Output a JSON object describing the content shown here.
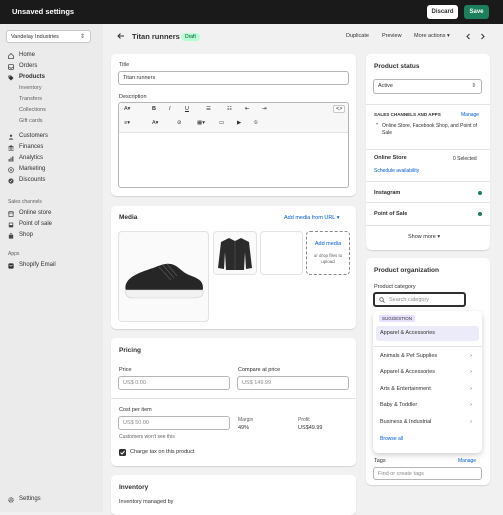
{
  "topbar": {
    "title": "Unsaved settings",
    "discard": "Discard",
    "save": "Save"
  },
  "sidebar": {
    "store": "Vandelay Industries",
    "items": [
      "Home",
      "Orders",
      "Products",
      "Inventory",
      "Transfers",
      "Collections",
      "Gift cards",
      "Customers",
      "Finances",
      "Analytics",
      "Marketing",
      "Discounts"
    ],
    "sales_label": "Sales channels",
    "sales": [
      "Online store",
      "Point of sale",
      "Shop"
    ],
    "apps_label": "Apps",
    "apps": [
      "Shopify Email"
    ],
    "settings": "Settings"
  },
  "header": {
    "title": "Titan runners",
    "badge": "Draft",
    "duplicate": "Duplicate",
    "preview": "Preview",
    "more": "More actions"
  },
  "title_card": {
    "title_label": "Title",
    "title_value": "Titan runners",
    "desc_label": "Description"
  },
  "media": {
    "heading": "Media",
    "add_from_url": "Add media from URL",
    "add_media": "Add media",
    "drop_hint": "or drop files to upload"
  },
  "pricing": {
    "heading": "Pricing",
    "price_label": "Price",
    "price_value": "US$  0.00",
    "compare_label": "Compare at price",
    "compare_value": "US$  149.99",
    "cost_label": "Cost per item",
    "cost_value": "US$  50.00",
    "cost_hint": "Customers won't see this",
    "margin_label": "Margin",
    "margin_value": "49%",
    "profit_label": "Profit",
    "profit_value": "US$49.99",
    "tax_label": "Charge tax on this product"
  },
  "inventory": {
    "heading": "Inventory",
    "managed_label": "Inventory managed by"
  },
  "status": {
    "heading": "Product status",
    "value": "Active",
    "channels_label": "SALES CHANNELS AND APPS",
    "manage": "Manage",
    "channels_desc": "Online Store, Facebook Shop, and Point of Sale",
    "online_store": "Online Store",
    "selected": "0 Selected",
    "schedule": "Schedule availability",
    "instagram": "Instagram",
    "pos": "Point of Sale",
    "show_more": "Show more"
  },
  "organization": {
    "heading": "Product organization",
    "category_label": "Product category",
    "search_placeholder": "Search category",
    "suggestion": "SUGGESTION",
    "suggested": "Apparel & Accessories",
    "categories": [
      "Animals & Pet Supplies",
      "Apparel & Accessories",
      "Arts & Entertainment",
      "Baby & Toddler",
      "Business & Industrial"
    ],
    "browse_all": "Browse all",
    "tags_label": "Tags",
    "tags_manage": "Manage",
    "tags_placeholder": "Find or create tags"
  },
  "colors": {
    "accent": "#1a7f5a",
    "link": "#005bd3",
    "topbar": "#1a1a1a"
  }
}
